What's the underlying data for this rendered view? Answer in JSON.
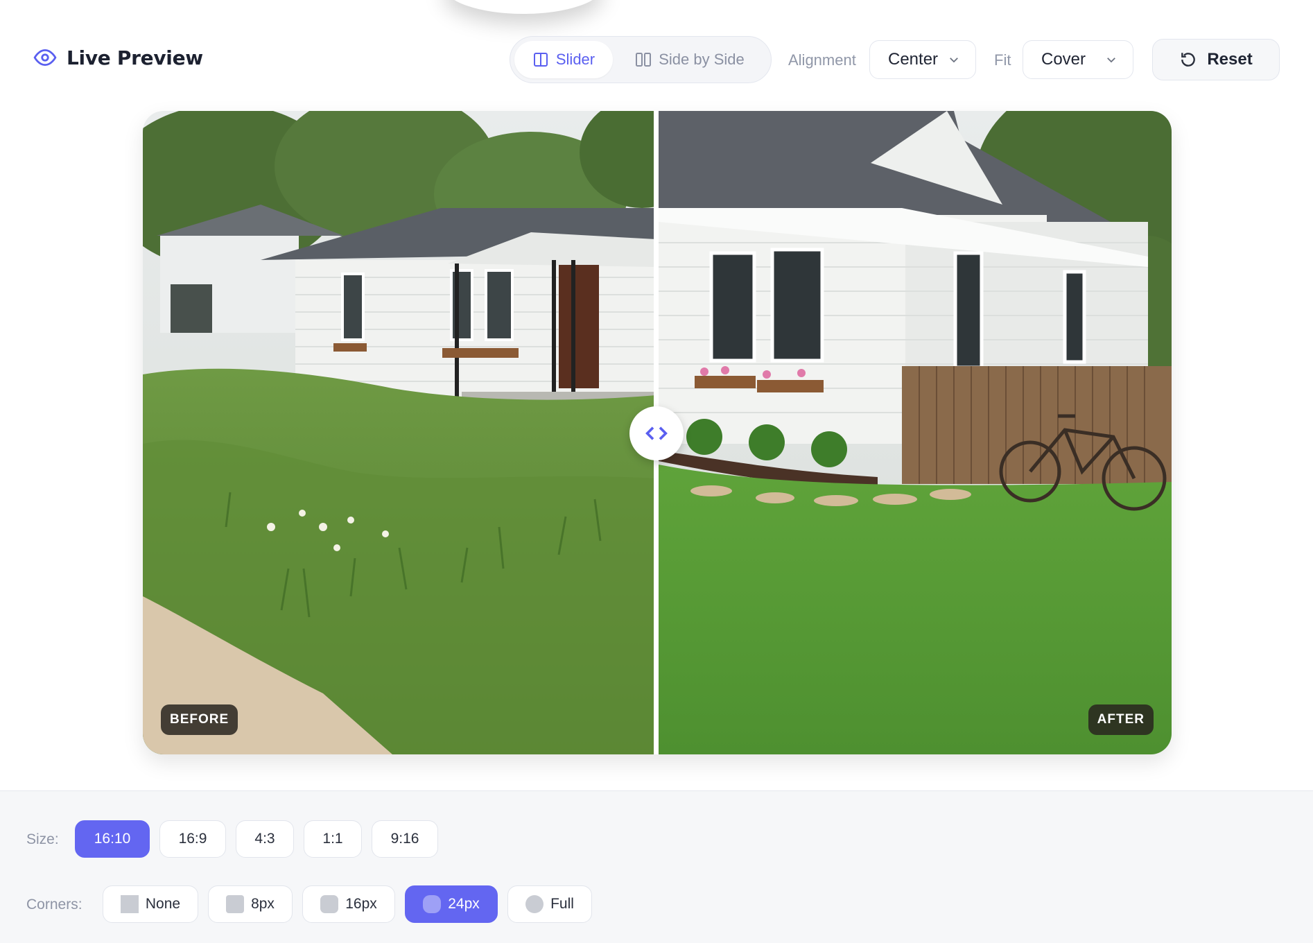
{
  "header": {
    "title": "Live Preview",
    "modes": [
      {
        "label": "Slider",
        "icon": "columns-icon",
        "active": true
      },
      {
        "label": "Side by Side",
        "icon": "side-by-side-icon",
        "active": false
      }
    ],
    "alignment": {
      "label": "Alignment",
      "value": "Center"
    },
    "fit": {
      "label": "Fit",
      "value": "Cover"
    },
    "reset_label": "Reset"
  },
  "preview": {
    "before_label": "BEFORE",
    "after_label": "AFTER",
    "slider_position": 0.5
  },
  "options": {
    "size_label": "Size:",
    "sizes": [
      {
        "label": "16:10",
        "selected": true
      },
      {
        "label": "16:9",
        "selected": false
      },
      {
        "label": "4:3",
        "selected": false
      },
      {
        "label": "1:1",
        "selected": false
      },
      {
        "label": "9:16",
        "selected": false
      }
    ],
    "corners_label": "Corners:",
    "corners": [
      {
        "label": "None",
        "selected": false
      },
      {
        "label": "8px",
        "selected": false
      },
      {
        "label": "16px",
        "selected": false
      },
      {
        "label": "24px",
        "selected": true
      },
      {
        "label": "Full",
        "selected": false
      }
    ]
  },
  "colors": {
    "accent": "#6366f1",
    "text": "#1f2433",
    "muted": "#8e94a5"
  }
}
